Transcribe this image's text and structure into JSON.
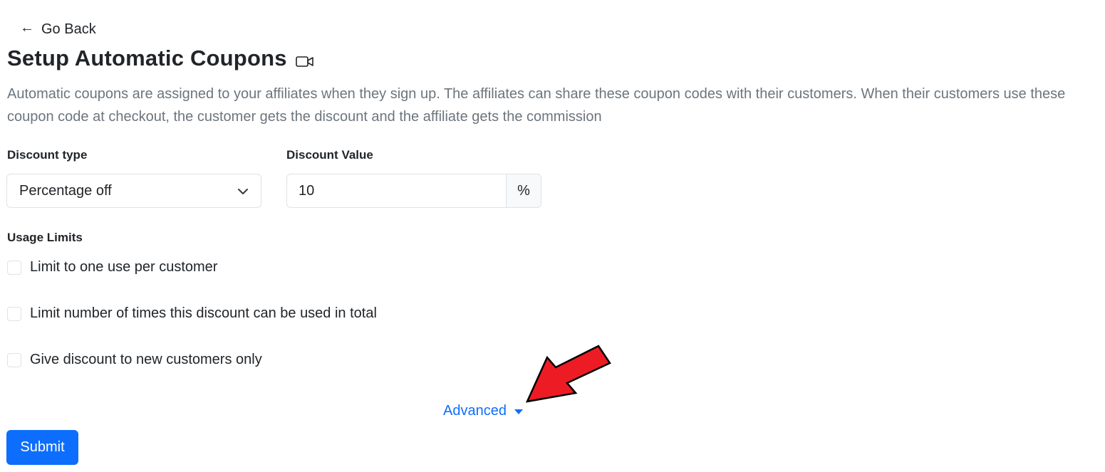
{
  "nav": {
    "back_arrow": "←",
    "back_label": "Go Back"
  },
  "header": {
    "title": "Setup Automatic Coupons",
    "title_icon": "video-camera-icon"
  },
  "description": "Automatic coupons are assigned to your affiliates when they sign up. The affiliates can share these coupon codes with their customers. When their customers use these coupon code at checkout, the customer gets the discount and the affiliate gets the commission",
  "form": {
    "discount_type": {
      "label": "Discount type",
      "selected": "Percentage off"
    },
    "discount_value": {
      "label": "Discount Value",
      "value": "10",
      "suffix": "%"
    },
    "usage_limits": {
      "label": "Usage Limits",
      "options": [
        {
          "label": "Limit to one use per customer",
          "checked": false
        },
        {
          "label": "Limit number of times this discount can be used in total",
          "checked": false
        },
        {
          "label": "Give discount to new customers only",
          "checked": false
        }
      ]
    },
    "advanced_label": "Advanced",
    "submit_label": "Submit"
  },
  "colors": {
    "primary": "#0d6efd",
    "muted_text": "#6c757d",
    "annotation_arrow": "#ed1c24"
  }
}
